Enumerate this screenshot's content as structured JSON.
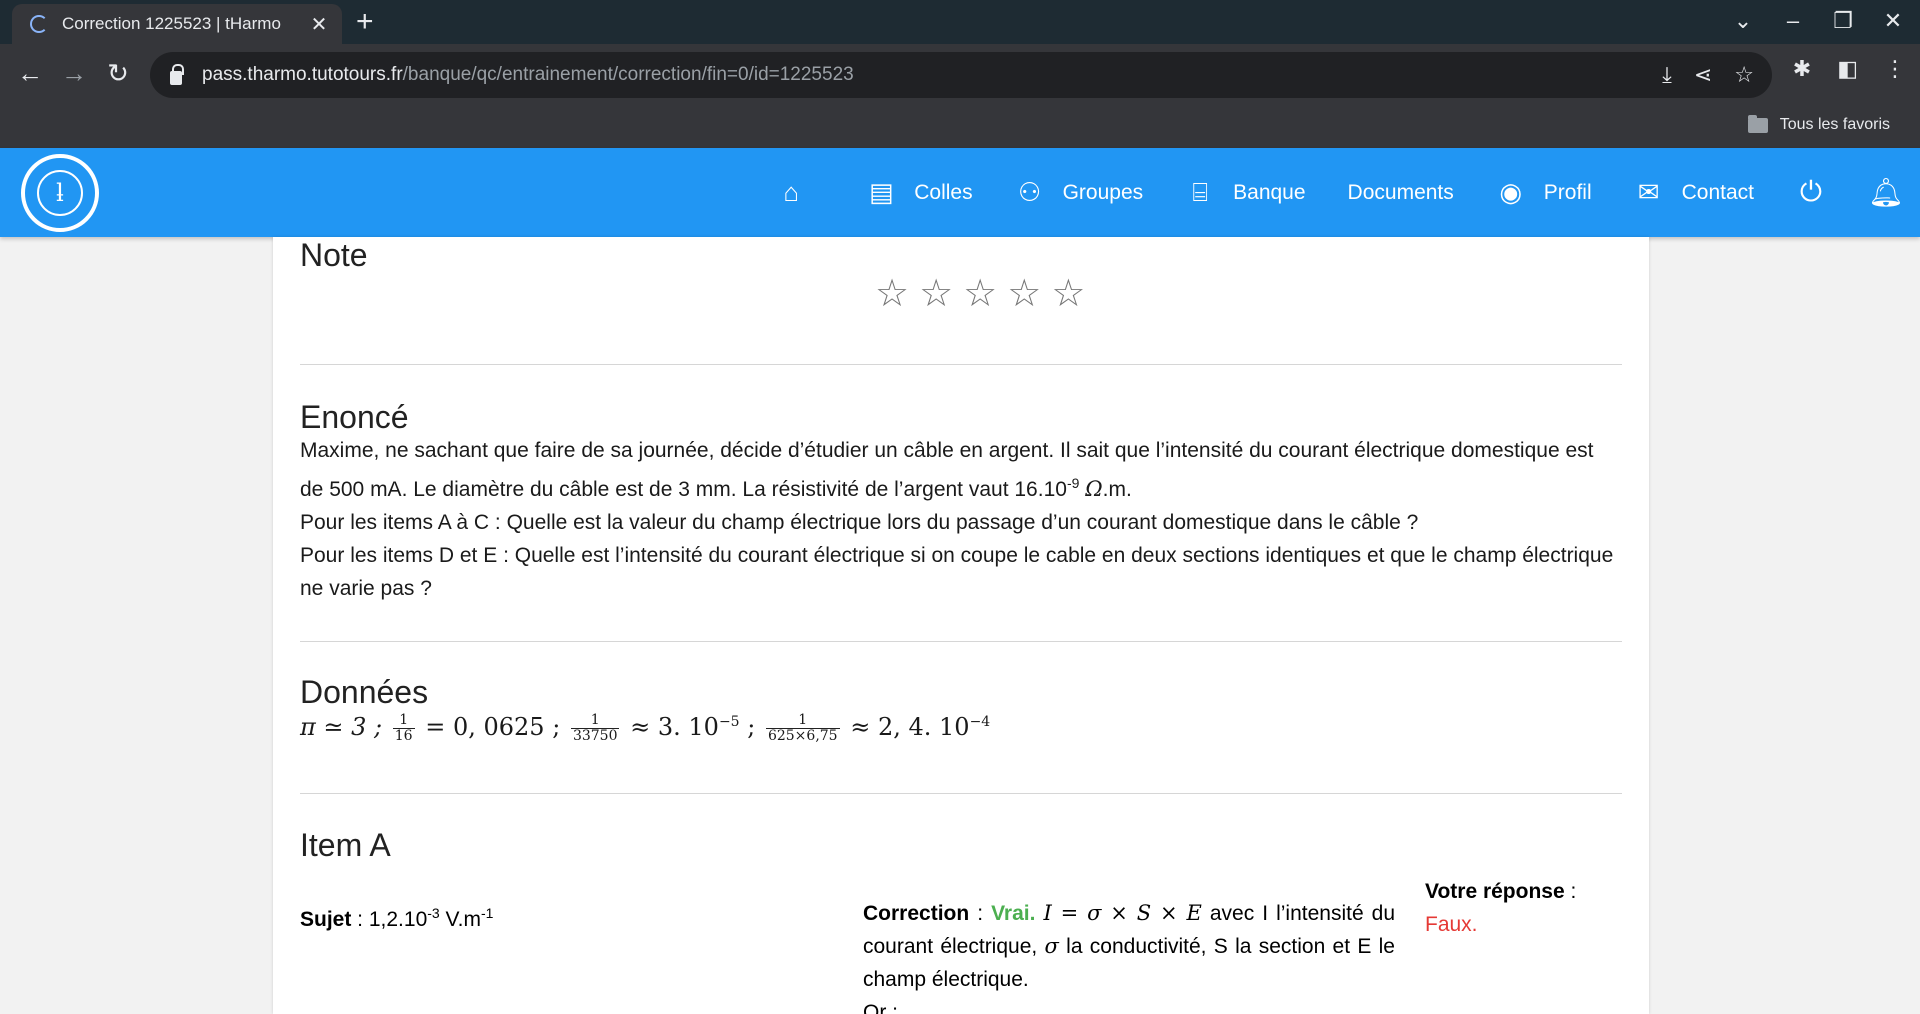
{
  "browser": {
    "tab_title": "Correction 1225523 | tHarmo",
    "url_host": "pass.tharmo.tutotours.fr",
    "url_path": "/banque/qc/entrainement/correction/fin=0/id=1225523",
    "bookmark_folder": "Tous les favoris"
  },
  "nav": {
    "items": [
      {
        "label": ""
      },
      {
        "label": "Colles"
      },
      {
        "label": "Groupes"
      },
      {
        "label": "Banque"
      },
      {
        "label": "Documents"
      },
      {
        "label": "Profil"
      },
      {
        "label": "Contact"
      }
    ],
    "brand_color": "#2196f3"
  },
  "note": {
    "title": "Note",
    "rating": 0,
    "max": 5
  },
  "enonce": {
    "title": "Enoncé",
    "line1": "Maxime, ne sachant que faire de sa journée, décide d’étudier un câble en argent. Il sait que l’intensité du courant électrique domestique est de 500 mA. Le diamètre du câble est de 3 mm. La résistivité de l’argent vaut 16.10",
    "line1_exp": "-9",
    "line1_unit": "Ω",
    "line1_end": ".m.",
    "line2": "Pour les items A à C : Quelle est la valeur du champ électrique lors du passage d’un courant domestique dans le câble ?",
    "line3": "Pour les items D et E : Quelle est l’intensité du courant électrique si on coupe le cable en deux sections identiques et que le champ électrique ne varie pas ?"
  },
  "donnees": {
    "title": "Données",
    "pi": "π ≃ 3 ;",
    "f1_num": "1",
    "f1_den": "16",
    "f1_val": "= 0, 0625 ;",
    "f2_num": "1",
    "f2_den": "33750",
    "f2_val": "≈ 3. 10",
    "f2_exp": "−5",
    "sep": ";",
    "f3_num": "1",
    "f3_den": "625×6,75",
    "f3_val": "≈ 2, 4. 10",
    "f3_exp": "−4"
  },
  "item_a": {
    "title": "Item A",
    "sujet_label": "Sujet",
    "sujet_sep": " : ",
    "sujet_value": "1,2.10",
    "sujet_exp1": "-3",
    "sujet_unit": " V.m",
    "sujet_exp2": "-1",
    "correction_label": "Correction",
    "correction_sep": " : ",
    "correction_verdict": "Vrai.",
    "correction_formula": "I = σ × S × E",
    "correction_text1": " avec I l’intensité du courant électrique, ",
    "correction_sigma": "σ",
    "correction_text2": " la conductivité, S la section et E le champ électrique.",
    "correction_or": "Or :",
    "reponse_label": "Votre réponse",
    "reponse_sep": " :",
    "reponse_value": "Faux."
  }
}
